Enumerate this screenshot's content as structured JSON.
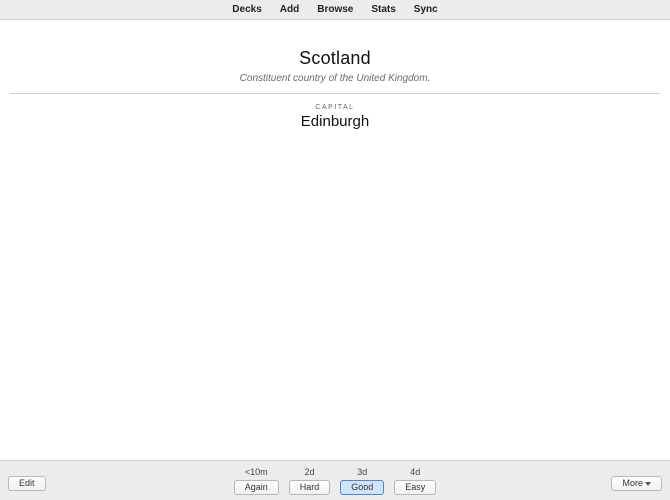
{
  "topnav": {
    "decks": "Decks",
    "add": "Add",
    "browse": "Browse",
    "stats": "Stats",
    "sync": "Sync"
  },
  "card": {
    "front_title": "Scotland",
    "front_sub": "Constituent country of the United Kingdom.",
    "back_label": "CAPITAL",
    "back_value": "Edinburgh"
  },
  "review": {
    "intervals": {
      "again": "<10m",
      "hard": "2d",
      "good": "3d",
      "easy": "4d"
    },
    "labels": {
      "again": "Again",
      "hard": "Hard",
      "good": "Good",
      "easy": "Easy"
    }
  },
  "bottom": {
    "edit": "Edit",
    "more": "More"
  }
}
